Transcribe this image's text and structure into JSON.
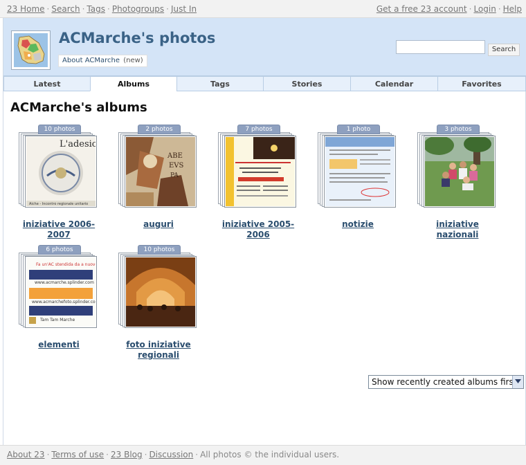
{
  "topbar": {
    "left_links": [
      "23 Home",
      "Search",
      "Tags",
      "Photogroups",
      "Just In"
    ],
    "right_links": [
      "Get a free 23 account",
      "Login",
      "Help"
    ]
  },
  "header": {
    "title": "ACMarche's photos",
    "about_label": "About ACMarche",
    "about_new": "(new)",
    "search_value": "",
    "search_button": "Search"
  },
  "tabs": [
    {
      "label": "Latest",
      "active": false
    },
    {
      "label": "Albums",
      "active": true
    },
    {
      "label": "Tags",
      "active": false
    },
    {
      "label": "Stories",
      "active": false
    },
    {
      "label": "Calendar",
      "active": false
    },
    {
      "label": "Favorites",
      "active": false
    }
  ],
  "main": {
    "heading": "ACMarche's albums",
    "albums": [
      {
        "title": "iniziative 2006-2007",
        "count": "10 photos"
      },
      {
        "title": "auguri",
        "count": "2 photos"
      },
      {
        "title": "iniziative 2005-2006",
        "count": "7 photos"
      },
      {
        "title": "notizie",
        "count": "1 photo"
      },
      {
        "title": "iniziative nazionali",
        "count": "3 photos"
      },
      {
        "title": "elementi",
        "count": "6 photos"
      },
      {
        "title": "foto iniziative regionali",
        "count": "10 photos"
      }
    ],
    "sort_selected": "Show recently created albums first"
  },
  "footer": {
    "links": [
      "About 23",
      "Terms of use",
      "23 Blog",
      "Discussion"
    ],
    "notice": "All photos © the individual users."
  },
  "colors": {
    "header_bg": "#d4e4f7",
    "title": "#3a6286",
    "link": "#2a4d6e",
    "count_badge": "#8ea0bf"
  }
}
